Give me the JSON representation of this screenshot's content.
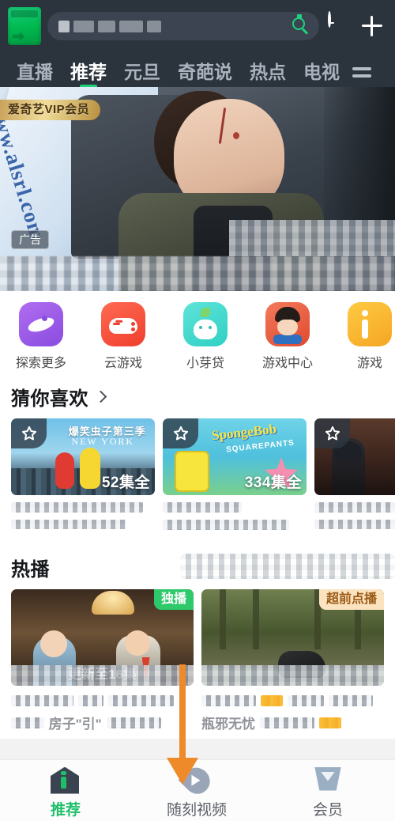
{
  "header": {
    "logo_name": "iqiyi-logo",
    "search": {
      "placeholder": "",
      "value": "",
      "icon": "search-icon"
    },
    "history_icon": "clock-icon",
    "add_icon": "plus-icon",
    "tabs": [
      {
        "label": "直播",
        "active": false
      },
      {
        "label": "推荐",
        "active": true
      },
      {
        "label": "元旦",
        "active": false
      },
      {
        "label": "奇葩说",
        "active": false
      },
      {
        "label": "热点",
        "active": false
      },
      {
        "label": "电视",
        "active": false
      }
    ],
    "menu_icon": "hamburger-menu-icon"
  },
  "banner": {
    "vip_badge": "爱奇艺VIP会员",
    "ad_badge": "广告",
    "watermark_url": "www.alsrl.com"
  },
  "shortcuts": [
    {
      "label": "探索更多",
      "icon": "explore-icon"
    },
    {
      "label": "云游戏",
      "icon": "cloud-game-icon"
    },
    {
      "label": "小芽贷",
      "icon": "sprout-loan-icon"
    },
    {
      "label": "游戏中心",
      "icon": "game-center-icon"
    },
    {
      "label": "游戏",
      "icon": "game-icon"
    }
  ],
  "guess_section": {
    "title": "猜你喜欢",
    "has_chevron": true,
    "cards": [
      {
        "art": "t-nyc",
        "episodes": "52集全",
        "title_line1": "",
        "title_line2": "",
        "star_icon": "star-outline-icon",
        "art_text_main": "爆笑虫子第三季",
        "art_text_sub": "NEW YORK"
      },
      {
        "art": "t-sponge",
        "episodes": "334集全",
        "title_line1": "",
        "title_line2": "",
        "star_icon": "star-outline-icon",
        "art_text_main": "SpongeBob",
        "art_text_sub": "SQUAREPANTS"
      },
      {
        "art": "t-show",
        "episodes": "",
        "title_line1": "",
        "title_line2": "",
        "star_icon": "star-outline-icon",
        "art_text_main": "",
        "art_text_sub": ""
      }
    ]
  },
  "hot_section": {
    "title": "热播",
    "cards": [
      {
        "art": "t-class",
        "badge": "独播",
        "badge_style": "cb-green",
        "overlay_text": "更新至16集",
        "sub_text": "房子\"引\""
      },
      {
        "art": "t-jungle",
        "badge": "超前点播",
        "badge_style": "cb-orange",
        "overlay_text": "",
        "sub_text": "瓶邪无忧"
      }
    ]
  },
  "bottom_nav": {
    "items": [
      {
        "label": "推荐",
        "icon": "home-icon",
        "active": true
      },
      {
        "label": "随刻视频",
        "icon": "flame-icon",
        "active": false
      },
      {
        "label": "会员",
        "icon": "vip-crown-icon",
        "active": false
      }
    ]
  },
  "annotation": {
    "arrow_color": "#ee8a2a",
    "points_at": "会员"
  }
}
